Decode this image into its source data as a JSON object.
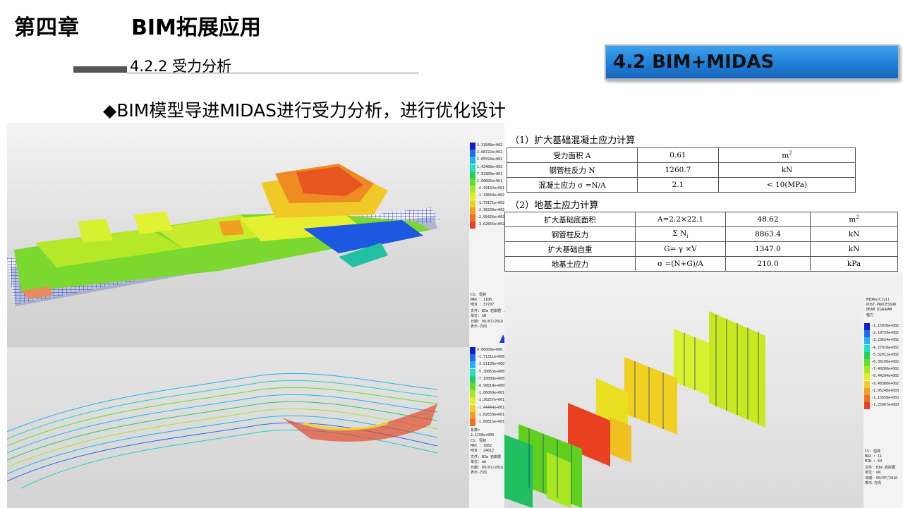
{
  "header": {
    "chapter": "第四章",
    "title": "BIM拓展应用"
  },
  "section": {
    "title": "4.2.2 受力分析"
  },
  "badge": {
    "label": "4.2  BIM+MIDAS",
    "color": "#2a8be0"
  },
  "bullet": {
    "text": "◆BIM模型导进MIDAS进行受力分析，进行优化设计"
  },
  "table1": {
    "title": "（1）扩大基础混凝土应力计算",
    "rows": [
      {
        "name": "受力面积 A",
        "value": "0.61",
        "unit": "m",
        "unit_sup": "2"
      },
      {
        "name": "钢管柱反力 N",
        "value": "1260.7",
        "unit": "kN",
        "unit_sup": ""
      },
      {
        "name": "混凝土应力 σ =N/A",
        "value": "2.1",
        "unit": "<   10(MPa)",
        "unit_sup": ""
      }
    ]
  },
  "table2": {
    "title": "（2）地基土应力计算",
    "rows": [
      {
        "name": "扩大基础底面积",
        "formula": "A=2.2×22.1",
        "value": "48.62",
        "unit": "m",
        "unit_sup": "2",
        "formula_sub": ""
      },
      {
        "name": "钢管柱反力",
        "formula": "Σ N",
        "formula_sub": "i",
        "value": "8863.4",
        "unit": "kN",
        "unit_sup": ""
      },
      {
        "name": "扩大基础自重",
        "formula": "G= γ ×V",
        "formula_sub": "",
        "value": "1347.0",
        "unit": "kN",
        "unit_sup": ""
      },
      {
        "name": "地基土应力",
        "formula": "σ =(N+G)/A",
        "formula_sub": "",
        "value": "210.0",
        "unit": "kPa",
        "unit_sup": ""
      }
    ]
  },
  "legend_a": {
    "colors": [
      "#1020d0",
      "#1e6cf0",
      "#20b4f0",
      "#20e0c8",
      "#20d060",
      "#60e020",
      "#a8e820",
      "#e0f020",
      "#f0d020",
      "#f0a020",
      "#f07020",
      "#e84020",
      "#d01818"
    ],
    "values": [
      "3.31848e+002",
      "2.68722e+002",
      "2.05594e+002",
      "1.42468e+002",
      "7.93389e+001",
      "1.60606e+001",
      "-4.49162e+001",
      "-1.10844e+002",
      "-1.73171e+002",
      "-2.36239e+002",
      "-2.99426e+002",
      "-3.62855e+002"
    ],
    "footer": [
      "CS: 恒荷",
      "MAX : 1106",
      "MIN : 37707",
      "文件: BIm 岩岸据 ...",
      "单位: kN",
      "日期: 09/07/2016",
      "表示-方向"
    ]
  },
  "legend_b": {
    "colors": [
      "#1020d0",
      "#1e6cf0",
      "#20b4f0",
      "#20e0c8",
      "#20d060",
      "#60e020",
      "#a8e820",
      "#e0f020",
      "#f0d020",
      "#f0a020",
      "#f07020",
      "#e84020",
      "#d01818"
    ],
    "values": [
      "9.06000e+000",
      "-1.71311e+000",
      "-3.51136e+000",
      "-5.30863e+000",
      "-7.10008e+000",
      "-8.90814e+000",
      "-1.06069e+001",
      "-1.26257e+001",
      "-1.44444e+001",
      "-1.62633e+001",
      "-1.80815e+001"
    ],
    "footer": [
      "系数=",
      "2.1158e+000",
      "CS: 恒荷",
      "MAX : 1862",
      "MIN : 24612",
      "文件: BIm 岩岸据",
      "单位: mm",
      "日期: 09/07/2016",
      "表示-方向"
    ]
  },
  "legend_c": {
    "header": [
      "MIDAS/Civil",
      "POST-PROCESSOR",
      "BEAM DIAGRAM",
      "轴力"
    ],
    "colors": [
      "#1020d0",
      "#1e6cf0",
      "#20b4f0",
      "#20e0c8",
      "#20d060",
      "#60e020",
      "#a8e820",
      "#e0f020",
      "#f0d020",
      "#f0a020",
      "#f07020",
      "#e84020",
      "#d01818"
    ],
    "values": [
      "-1.15036e+002",
      "-2.19739e+002",
      "-3.23624e+002",
      "-4.27918e+002",
      "-5.32012e+002",
      "-6.36106e+002",
      "-7.40200e+002",
      "-8.44294e+002",
      "-9.48388e+002",
      "-1.05248e+003",
      "-1.15658e+003",
      "-1.25067e+003"
    ],
    "footer": [
      "CS: 恒荷",
      "MAX : 11",
      "MIN : 69",
      "文件: BIm 岩岸据",
      "单位: kN",
      "日期: 09/07/2016",
      "表示-方向"
    ]
  }
}
